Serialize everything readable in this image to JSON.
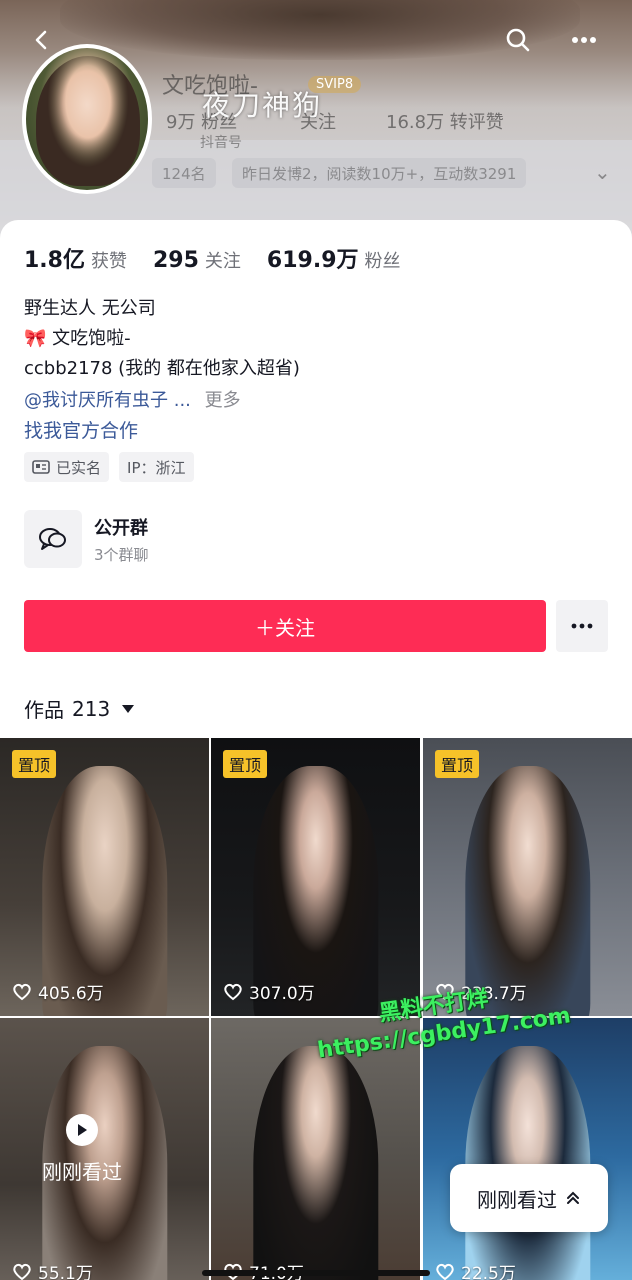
{
  "header": {
    "ghost_name": "文吃饱啦-",
    "ghost_badge": "SVIP8",
    "ghost_stats": [
      "9万 粉丝",
      "关注",
      "16.8万 转评赞"
    ],
    "ghost_subtitle": "抖音号",
    "ghost_pills": [
      "124名",
      "昨日发博2，阅读数10万+，互动数3291"
    ],
    "watermark": "夜刀神狗"
  },
  "stats": [
    {
      "value": "1.8亿",
      "label": "获赞"
    },
    {
      "value": "295",
      "label": "关注"
    },
    {
      "value": "619.9万",
      "label": "粉丝"
    }
  ],
  "bio": {
    "line1": "野生达人 无公司",
    "line2": "文吃饱啦-",
    "line3": "ccbb2178 (我的 都在他家入超省)",
    "line4_link": "@我讨厌所有虫子 ...",
    "line4_more": "更多",
    "cta": "找我官方合作"
  },
  "tags": [
    {
      "icon": "id-card-icon",
      "label": "已实名"
    },
    {
      "icon": "",
      "label": "IP：浙江"
    }
  ],
  "group": {
    "title": "公开群",
    "subtitle": "3个群聊"
  },
  "follow_button": "＋关注",
  "works": {
    "label": "作品",
    "count": "213"
  },
  "tiles": [
    {
      "pinned": true,
      "pin_label": "置顶",
      "likes": "405.6万",
      "bg": "#3a3632",
      "accent": "#6b6058"
    },
    {
      "pinned": true,
      "pin_label": "置顶",
      "likes": "307.0万",
      "bg": "#151515",
      "accent": "#1f1f22"
    },
    {
      "pinned": true,
      "pin_label": "置顶",
      "likes": "238.7万",
      "bg": "#5a5e66",
      "accent": "#3b4d66"
    },
    {
      "pinned": false,
      "pin_label": "",
      "likes": "55.1万",
      "bg": "#4a4440",
      "accent": "#7c746c",
      "just_seen": "刚刚看过"
    },
    {
      "pinned": false,
      "pin_label": "",
      "likes": "71.0万",
      "bg": "#54514d",
      "accent": "#222"
    },
    {
      "pinned": false,
      "pin_label": "",
      "likes": "22.5万",
      "bg": "#2a5a88",
      "accent": "#9fd2ee"
    }
  ],
  "floating_button": "刚刚看过",
  "watermark_mid": [
    "黑料不打烊",
    "https://cgbdy17.com"
  ]
}
